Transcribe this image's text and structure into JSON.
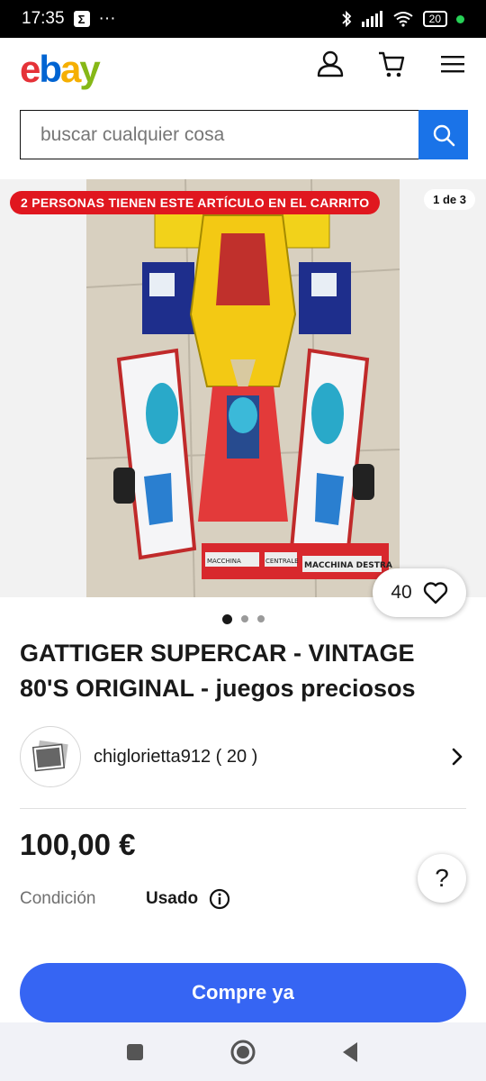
{
  "status": {
    "time": "17:35",
    "app_badge": "Σ",
    "dots": "···",
    "battery": "20"
  },
  "header": {
    "logo": [
      "e",
      "b",
      "a",
      "y"
    ]
  },
  "search": {
    "placeholder": "buscar cualquier cosa"
  },
  "gallery": {
    "cart_banner": "2 PERSONAS TIENEN ESTE ARTÍCULO EN EL CARRITO",
    "counter": "1 de 3",
    "watch_count": "40",
    "toy_labels": [
      "MACCHINA",
      "CENTRALE",
      "MACCHINA DESTRA"
    ]
  },
  "listing": {
    "title": "GATTIGER SUPERCAR - VINTAGE 80'S ORIGINAL - juegos preciosos",
    "seller": "chiglorietta912 ( 20 )",
    "price": "100,00 €",
    "condition_label": "Condición",
    "condition_value": "Usado",
    "help": "?",
    "buy_label": "Compre ya"
  },
  "colors": {
    "accent": "#3665f3",
    "banner": "#e0171f"
  }
}
